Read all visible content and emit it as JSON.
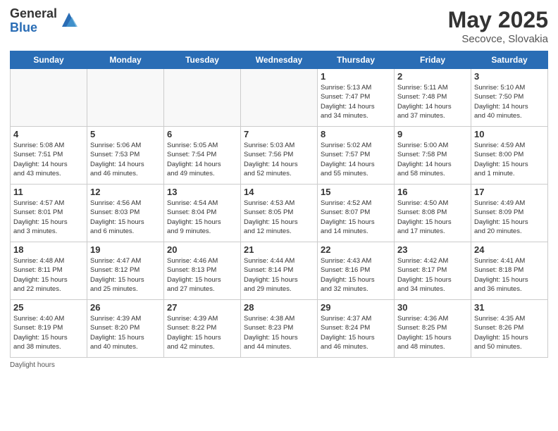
{
  "logo": {
    "general": "General",
    "blue": "Blue"
  },
  "title": {
    "month": "May 2025",
    "location": "Secovce, Slovakia"
  },
  "days_of_week": [
    "Sunday",
    "Monday",
    "Tuesday",
    "Wednesday",
    "Thursday",
    "Friday",
    "Saturday"
  ],
  "footer": {
    "daylight_label": "Daylight hours"
  },
  "weeks": [
    [
      {
        "day": "",
        "info": ""
      },
      {
        "day": "",
        "info": ""
      },
      {
        "day": "",
        "info": ""
      },
      {
        "day": "",
        "info": ""
      },
      {
        "day": "1",
        "info": "Sunrise: 5:13 AM\nSunset: 7:47 PM\nDaylight: 14 hours\nand 34 minutes."
      },
      {
        "day": "2",
        "info": "Sunrise: 5:11 AM\nSunset: 7:48 PM\nDaylight: 14 hours\nand 37 minutes."
      },
      {
        "day": "3",
        "info": "Sunrise: 5:10 AM\nSunset: 7:50 PM\nDaylight: 14 hours\nand 40 minutes."
      }
    ],
    [
      {
        "day": "4",
        "info": "Sunrise: 5:08 AM\nSunset: 7:51 PM\nDaylight: 14 hours\nand 43 minutes."
      },
      {
        "day": "5",
        "info": "Sunrise: 5:06 AM\nSunset: 7:53 PM\nDaylight: 14 hours\nand 46 minutes."
      },
      {
        "day": "6",
        "info": "Sunrise: 5:05 AM\nSunset: 7:54 PM\nDaylight: 14 hours\nand 49 minutes."
      },
      {
        "day": "7",
        "info": "Sunrise: 5:03 AM\nSunset: 7:56 PM\nDaylight: 14 hours\nand 52 minutes."
      },
      {
        "day": "8",
        "info": "Sunrise: 5:02 AM\nSunset: 7:57 PM\nDaylight: 14 hours\nand 55 minutes."
      },
      {
        "day": "9",
        "info": "Sunrise: 5:00 AM\nSunset: 7:58 PM\nDaylight: 14 hours\nand 58 minutes."
      },
      {
        "day": "10",
        "info": "Sunrise: 4:59 AM\nSunset: 8:00 PM\nDaylight: 15 hours\nand 1 minute."
      }
    ],
    [
      {
        "day": "11",
        "info": "Sunrise: 4:57 AM\nSunset: 8:01 PM\nDaylight: 15 hours\nand 3 minutes."
      },
      {
        "day": "12",
        "info": "Sunrise: 4:56 AM\nSunset: 8:03 PM\nDaylight: 15 hours\nand 6 minutes."
      },
      {
        "day": "13",
        "info": "Sunrise: 4:54 AM\nSunset: 8:04 PM\nDaylight: 15 hours\nand 9 minutes."
      },
      {
        "day": "14",
        "info": "Sunrise: 4:53 AM\nSunset: 8:05 PM\nDaylight: 15 hours\nand 12 minutes."
      },
      {
        "day": "15",
        "info": "Sunrise: 4:52 AM\nSunset: 8:07 PM\nDaylight: 15 hours\nand 14 minutes."
      },
      {
        "day": "16",
        "info": "Sunrise: 4:50 AM\nSunset: 8:08 PM\nDaylight: 15 hours\nand 17 minutes."
      },
      {
        "day": "17",
        "info": "Sunrise: 4:49 AM\nSunset: 8:09 PM\nDaylight: 15 hours\nand 20 minutes."
      }
    ],
    [
      {
        "day": "18",
        "info": "Sunrise: 4:48 AM\nSunset: 8:11 PM\nDaylight: 15 hours\nand 22 minutes."
      },
      {
        "day": "19",
        "info": "Sunrise: 4:47 AM\nSunset: 8:12 PM\nDaylight: 15 hours\nand 25 minutes."
      },
      {
        "day": "20",
        "info": "Sunrise: 4:46 AM\nSunset: 8:13 PM\nDaylight: 15 hours\nand 27 minutes."
      },
      {
        "day": "21",
        "info": "Sunrise: 4:44 AM\nSunset: 8:14 PM\nDaylight: 15 hours\nand 29 minutes."
      },
      {
        "day": "22",
        "info": "Sunrise: 4:43 AM\nSunset: 8:16 PM\nDaylight: 15 hours\nand 32 minutes."
      },
      {
        "day": "23",
        "info": "Sunrise: 4:42 AM\nSunset: 8:17 PM\nDaylight: 15 hours\nand 34 minutes."
      },
      {
        "day": "24",
        "info": "Sunrise: 4:41 AM\nSunset: 8:18 PM\nDaylight: 15 hours\nand 36 minutes."
      }
    ],
    [
      {
        "day": "25",
        "info": "Sunrise: 4:40 AM\nSunset: 8:19 PM\nDaylight: 15 hours\nand 38 minutes."
      },
      {
        "day": "26",
        "info": "Sunrise: 4:39 AM\nSunset: 8:20 PM\nDaylight: 15 hours\nand 40 minutes."
      },
      {
        "day": "27",
        "info": "Sunrise: 4:39 AM\nSunset: 8:22 PM\nDaylight: 15 hours\nand 42 minutes."
      },
      {
        "day": "28",
        "info": "Sunrise: 4:38 AM\nSunset: 8:23 PM\nDaylight: 15 hours\nand 44 minutes."
      },
      {
        "day": "29",
        "info": "Sunrise: 4:37 AM\nSunset: 8:24 PM\nDaylight: 15 hours\nand 46 minutes."
      },
      {
        "day": "30",
        "info": "Sunrise: 4:36 AM\nSunset: 8:25 PM\nDaylight: 15 hours\nand 48 minutes."
      },
      {
        "day": "31",
        "info": "Sunrise: 4:35 AM\nSunset: 8:26 PM\nDaylight: 15 hours\nand 50 minutes."
      }
    ]
  ]
}
